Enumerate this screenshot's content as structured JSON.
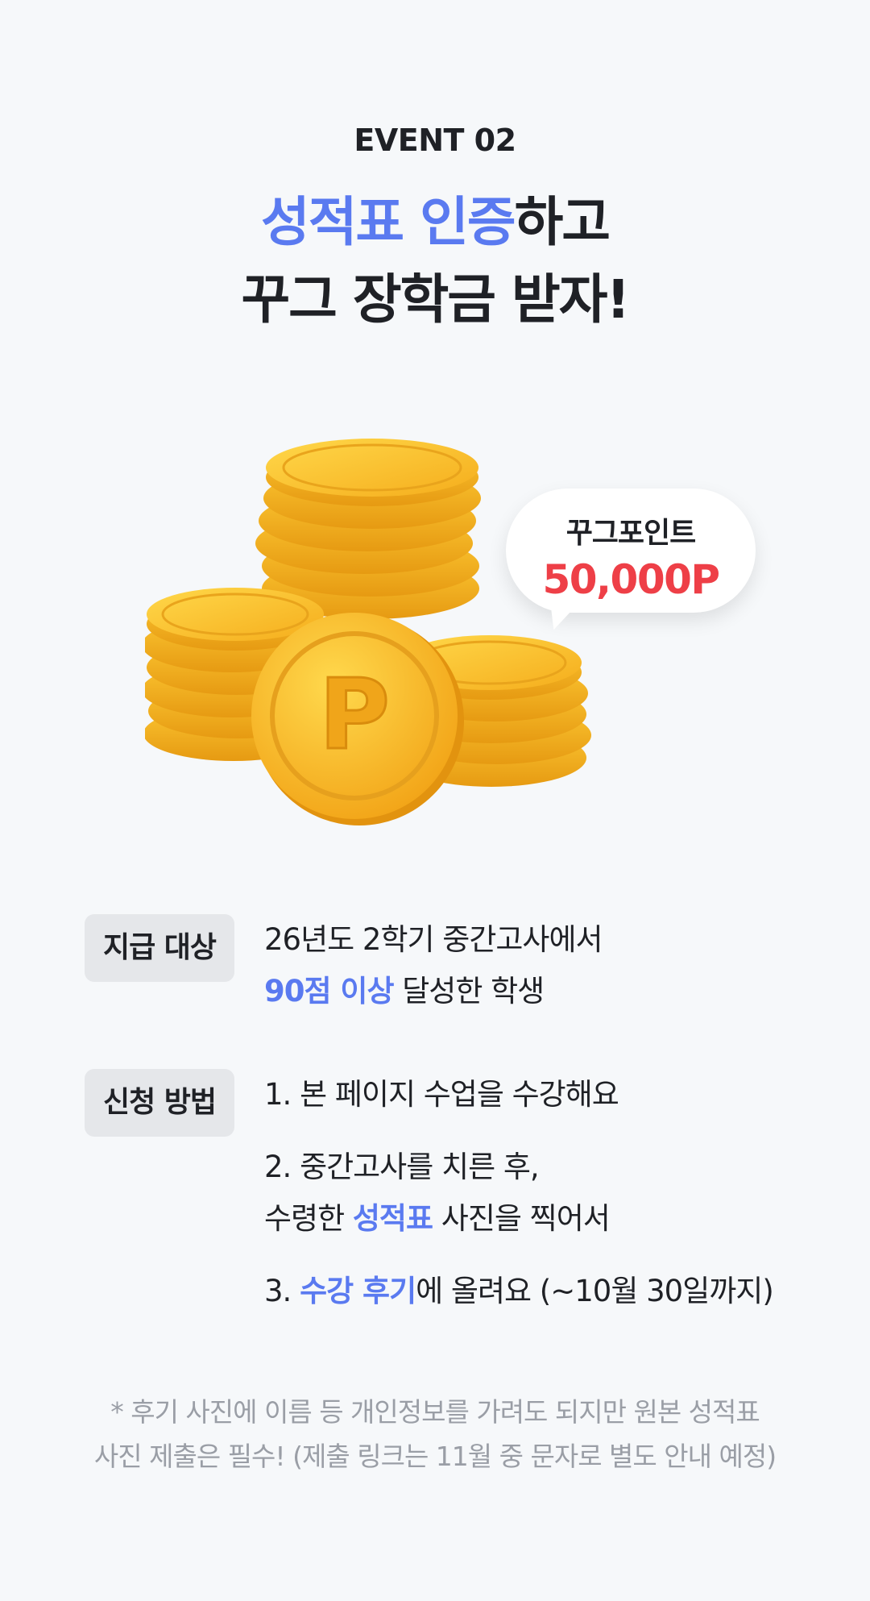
{
  "event": {
    "label": "EVENT 02"
  },
  "headline": {
    "line1_accent": "성적표 인증",
    "line1_rest": "하고",
    "line2": "꾸그 장학금 받자!"
  },
  "illustration": {
    "coin_symbol": "P",
    "bubble_title": "꾸그포인트",
    "bubble_amount": "50,000P",
    "colors": {
      "coin": "#f7b928",
      "amount": "#ee3f47"
    }
  },
  "eligibility": {
    "badge": "지급 대상",
    "line1": "26년도 2학기 중간고사에서",
    "line2_accent": "90점 이상",
    "line2_rest": " 달성한 학생"
  },
  "how_to": {
    "badge": "신청 방법",
    "step1": "1. 본 페이지 수업을 수강해요",
    "step2_line1": "2. 중간고사를 치른 후,",
    "step2_line2_pre": "수령한 ",
    "step2_line2_accent": "성적표",
    "step2_line2_post": " 사진을 찍어서",
    "step3_pre": "3. ",
    "step3_accent": "수강 후기",
    "step3_post": "에 올려요 (~10월 30일까지)"
  },
  "note": {
    "line1": "* 후기 사진에 이름 등 개인정보를 가려도 되지만 원본 성적표",
    "line2": "사진 제출은 필수! (제출 링크는 11월 중 문자로 별도 안내 예정)"
  },
  "theme": {
    "accent": "#5a7af0",
    "background": "#f6f8fa",
    "badge_bg": "#e5e7ea"
  }
}
